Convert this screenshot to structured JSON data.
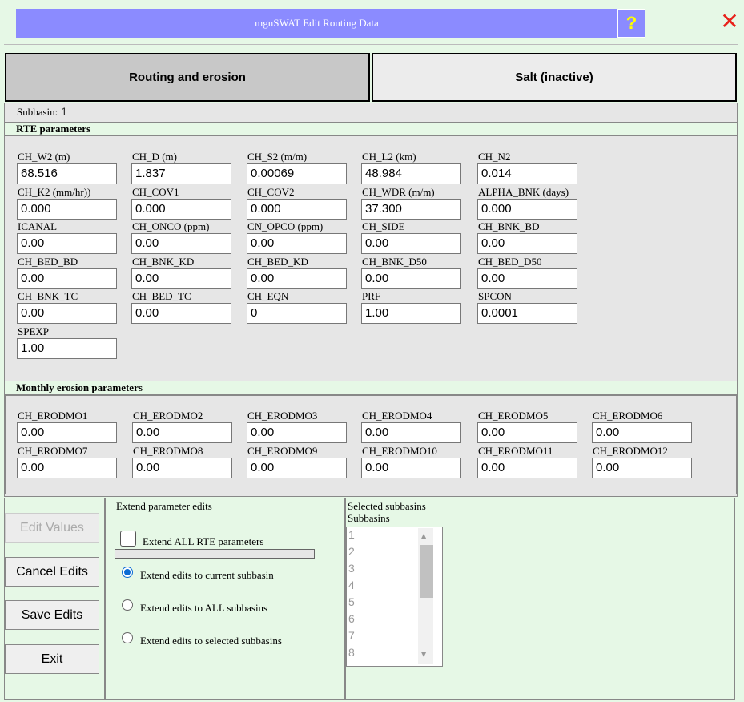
{
  "window": {
    "title": "mgnSWAT Edit Routing Data",
    "help_label": "?",
    "close_glyph": "✕",
    "colors": {
      "title_bar": "#8b8bff",
      "background": "#e6f8e6",
      "help_icon": "#ffff00",
      "close_icon": "#e8221b",
      "radio_selected": "#0b6cd4"
    }
  },
  "tabs": [
    {
      "label": "Routing and erosion",
      "active": true
    },
    {
      "label": "Salt (inactive)",
      "active": false
    }
  ],
  "subbasin": {
    "label": "Subbasin:",
    "value": "1"
  },
  "rte": {
    "header": "RTE parameters",
    "params": [
      {
        "label": "CH_W2 (m)",
        "value": "68.516"
      },
      {
        "label": "CH_D (m)",
        "value": "1.837"
      },
      {
        "label": "CH_S2 (m/m)",
        "value": "0.00069"
      },
      {
        "label": "CH_L2 (km)",
        "value": "48.984"
      },
      {
        "label": "CH_N2",
        "value": "0.014"
      },
      {
        "label": "CH_K2 (mm/hr))",
        "value": "0.000"
      },
      {
        "label": "CH_COV1",
        "value": "0.000"
      },
      {
        "label": "CH_COV2",
        "value": "0.000"
      },
      {
        "label": "CH_WDR (m/m)",
        "value": "37.300"
      },
      {
        "label": "ALPHA_BNK (days)",
        "value": "0.000"
      },
      {
        "label": "ICANAL",
        "value": "0.00"
      },
      {
        "label": "CH_ONCO (ppm)",
        "value": "0.00"
      },
      {
        "label": "CN_OPCO (ppm)",
        "value": "0.00"
      },
      {
        "label": "CH_SIDE",
        "value": "0.00"
      },
      {
        "label": "CH_BNK_BD",
        "value": "0.00"
      },
      {
        "label": "CH_BED_BD",
        "value": "0.00"
      },
      {
        "label": "CH_BNK_KD",
        "value": "0.00"
      },
      {
        "label": "CH_BED_KD",
        "value": "0.00"
      },
      {
        "label": "CH_BNK_D50",
        "value": "0.00"
      },
      {
        "label": "CH_BED_D50",
        "value": "0.00"
      },
      {
        "label": "CH_BNK_TC",
        "value": "0.00"
      },
      {
        "label": "CH_BED_TC",
        "value": "0.00"
      },
      {
        "label": "CH_EQN",
        "value": "0"
      },
      {
        "label": "PRF",
        "value": "1.00"
      },
      {
        "label": "SPCON",
        "value": "0.0001"
      },
      {
        "label": "SPEXP",
        "value": "1.00"
      }
    ]
  },
  "erosion": {
    "header": "Monthly erosion parameters",
    "params": [
      {
        "label": "CH_ERODMO1",
        "value": "0.00"
      },
      {
        "label": "CH_ERODMO2",
        "value": "0.00"
      },
      {
        "label": "CH_ERODMO3",
        "value": "0.00"
      },
      {
        "label": "CH_ERODMO4",
        "value": "0.00"
      },
      {
        "label": "CH_ERODMO5",
        "value": "0.00"
      },
      {
        "label": "CH_ERODMO6",
        "value": "0.00"
      },
      {
        "label": "CH_ERODMO7",
        "value": "0.00"
      },
      {
        "label": "CH_ERODMO8",
        "value": "0.00"
      },
      {
        "label": "CH_ERODMO9",
        "value": "0.00"
      },
      {
        "label": "CH_ERODMO10",
        "value": "0.00"
      },
      {
        "label": "CH_ERODMO11",
        "value": "0.00"
      },
      {
        "label": "CH_ERODMO12",
        "value": "0.00"
      }
    ]
  },
  "buttons": {
    "edit_values": "Edit Values",
    "cancel_edits": "Cancel Edits",
    "save_edits": "Save Edits",
    "exit": "Exit"
  },
  "extend": {
    "title": "Extend parameter edits",
    "checkbox_label": "Extend ALL RTE parameters",
    "checkbox_checked": false,
    "options": [
      {
        "label": "Extend edits to current subbasin",
        "selected": true
      },
      {
        "label": "Extend edits to ALL subbasins",
        "selected": false
      },
      {
        "label": "Extend edits to selected subbasins",
        "selected": false
      }
    ]
  },
  "selected_subbasins": {
    "title": "Selected subbasins",
    "list_label": "Subbasins",
    "items": [
      "1",
      "2",
      "3",
      "4",
      "5",
      "6",
      "7",
      "8"
    ]
  }
}
